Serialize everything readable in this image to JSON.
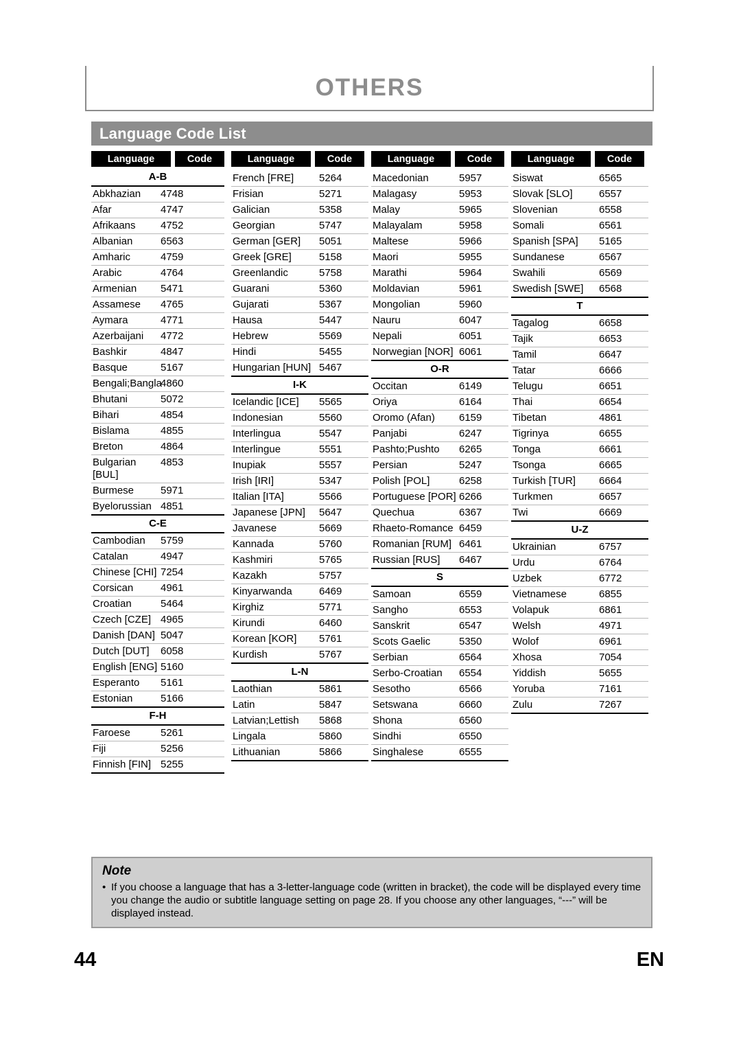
{
  "header": {
    "chapter_title": "OTHERS",
    "section_title": "Language Code List"
  },
  "table_headers": {
    "language": "Language",
    "code": "Code"
  },
  "columns": [
    {
      "id": "col-1",
      "blocks": [
        {
          "group": "A-B",
          "rows": [
            {
              "name": "Abkhazian",
              "code": "4748"
            },
            {
              "name": "Afar",
              "code": "4747"
            },
            {
              "name": "Afrikaans",
              "code": "4752"
            },
            {
              "name": "Albanian",
              "code": "6563"
            },
            {
              "name": "Amharic",
              "code": "4759"
            },
            {
              "name": "Arabic",
              "code": "4764"
            },
            {
              "name": "Armenian",
              "code": "5471"
            },
            {
              "name": "Assamese",
              "code": "4765"
            },
            {
              "name": "Aymara",
              "code": "4771"
            },
            {
              "name": "Azerbaijani",
              "code": "4772"
            },
            {
              "name": "Bashkir",
              "code": "4847"
            },
            {
              "name": "Basque",
              "code": "5167"
            },
            {
              "name": "Bengali;Bangla",
              "code": "4860"
            },
            {
              "name": "Bhutani",
              "code": "5072"
            },
            {
              "name": "Bihari",
              "code": "4854"
            },
            {
              "name": "Bislama",
              "code": "4855"
            },
            {
              "name": "Breton",
              "code": "4864"
            },
            {
              "name": "Bulgarian [BUL]",
              "code": "4853"
            },
            {
              "name": "Burmese",
              "code": "5971"
            },
            {
              "name": "Byelorussian",
              "code": "4851"
            }
          ]
        },
        {
          "group": "C-E",
          "rows": [
            {
              "name": "Cambodian",
              "code": "5759"
            },
            {
              "name": "Catalan",
              "code": "4947"
            },
            {
              "name": "Chinese [CHI]",
              "code": "7254"
            },
            {
              "name": "Corsican",
              "code": "4961"
            },
            {
              "name": "Croatian",
              "code": "5464"
            },
            {
              "name": "Czech [CZE]",
              "code": "4965"
            },
            {
              "name": "Danish [DAN]",
              "code": "5047"
            },
            {
              "name": "Dutch [DUT]",
              "code": "6058"
            },
            {
              "name": "English [ENG]",
              "code": "5160"
            },
            {
              "name": "Esperanto",
              "code": "5161"
            },
            {
              "name": "Estonian",
              "code": "5166"
            }
          ]
        },
        {
          "group": "F-H",
          "rows": [
            {
              "name": "Faroese",
              "code": "5261"
            },
            {
              "name": "Fiji",
              "code": "5256"
            },
            {
              "name": "Finnish [FIN]",
              "code": "5255"
            }
          ]
        }
      ]
    },
    {
      "id": "col-2",
      "blocks": [
        {
          "group": "",
          "rows": [
            {
              "name": "French [FRE]",
              "code": "5264"
            },
            {
              "name": "Frisian",
              "code": "5271"
            },
            {
              "name": "Galician",
              "code": "5358"
            },
            {
              "name": "Georgian",
              "code": "5747"
            },
            {
              "name": "German [GER]",
              "code": "5051"
            },
            {
              "name": "Greek [GRE]",
              "code": "5158"
            },
            {
              "name": "Greenlandic",
              "code": "5758"
            },
            {
              "name": "Guarani",
              "code": "5360"
            },
            {
              "name": "Gujarati",
              "code": "5367"
            },
            {
              "name": "Hausa",
              "code": "5447"
            },
            {
              "name": "Hebrew",
              "code": "5569"
            },
            {
              "name": "Hindi",
              "code": "5455"
            },
            {
              "name": "Hungarian [HUN]",
              "code": "5467"
            }
          ]
        },
        {
          "group": "I-K",
          "rows": [
            {
              "name": "Icelandic [ICE]",
              "code": "5565"
            },
            {
              "name": "Indonesian",
              "code": "5560"
            },
            {
              "name": "Interlingua",
              "code": "5547"
            },
            {
              "name": "Interlingue",
              "code": "5551"
            },
            {
              "name": "Inupiak",
              "code": "5557"
            },
            {
              "name": "Irish [IRI]",
              "code": "5347"
            },
            {
              "name": "Italian [ITA]",
              "code": "5566"
            },
            {
              "name": "Japanese [JPN]",
              "code": "5647"
            },
            {
              "name": "Javanese",
              "code": "5669"
            },
            {
              "name": "Kannada",
              "code": "5760"
            },
            {
              "name": "Kashmiri",
              "code": "5765"
            },
            {
              "name": "Kazakh",
              "code": "5757"
            },
            {
              "name": "Kinyarwanda",
              "code": "6469"
            },
            {
              "name": "Kirghiz",
              "code": "5771"
            },
            {
              "name": "Kirundi",
              "code": "6460"
            },
            {
              "name": "Korean [KOR]",
              "code": "5761"
            },
            {
              "name": "Kurdish",
              "code": "5767"
            }
          ]
        },
        {
          "group": "L-N",
          "rows": [
            {
              "name": "Laothian",
              "code": "5861"
            },
            {
              "name": "Latin",
              "code": "5847"
            },
            {
              "name": "Latvian;Lettish",
              "code": "5868"
            },
            {
              "name": "Lingala",
              "code": "5860"
            },
            {
              "name": "Lithuanian",
              "code": "5866"
            }
          ]
        }
      ]
    },
    {
      "id": "col-3",
      "blocks": [
        {
          "group": "",
          "rows": [
            {
              "name": "Macedonian",
              "code": "5957"
            },
            {
              "name": "Malagasy",
              "code": "5953"
            },
            {
              "name": "Malay",
              "code": "5965"
            },
            {
              "name": "Malayalam",
              "code": "5958"
            },
            {
              "name": "Maltese",
              "code": "5966"
            },
            {
              "name": "Maori",
              "code": "5955"
            },
            {
              "name": "Marathi",
              "code": "5964"
            },
            {
              "name": "Moldavian",
              "code": "5961"
            },
            {
              "name": "Mongolian",
              "code": "5960"
            },
            {
              "name": "Nauru",
              "code": "6047"
            },
            {
              "name": "Nepali",
              "code": "6051"
            },
            {
              "name": "Norwegian [NOR]",
              "code": "6061"
            }
          ]
        },
        {
          "group": "O-R",
          "rows": [
            {
              "name": "Occitan",
              "code": "6149"
            },
            {
              "name": "Oriya",
              "code": "6164"
            },
            {
              "name": "Oromo (Afan)",
              "code": "6159"
            },
            {
              "name": "Panjabi",
              "code": "6247"
            },
            {
              "name": "Pashto;Pushto",
              "code": "6265"
            },
            {
              "name": "Persian",
              "code": "5247"
            },
            {
              "name": "Polish [POL]",
              "code": "6258"
            },
            {
              "name": "Portuguese [POR]",
              "code": "6266"
            },
            {
              "name": "Quechua",
              "code": "6367"
            },
            {
              "name": "Rhaeto-Romance",
              "code": "6459"
            },
            {
              "name": "Romanian [RUM]",
              "code": "6461"
            },
            {
              "name": "Russian [RUS]",
              "code": "6467"
            }
          ]
        },
        {
          "group": "S",
          "rows": [
            {
              "name": "Samoan",
              "code": "6559"
            },
            {
              "name": "Sangho",
              "code": "6553"
            },
            {
              "name": "Sanskrit",
              "code": "6547"
            },
            {
              "name": "Scots Gaelic",
              "code": "5350"
            },
            {
              "name": "Serbian",
              "code": "6564"
            },
            {
              "name": "Serbo-Croatian",
              "code": "6554"
            },
            {
              "name": "Sesotho",
              "code": "6566"
            },
            {
              "name": "Setswana",
              "code": "6660"
            },
            {
              "name": "Shona",
              "code": "6560"
            },
            {
              "name": "Sindhi",
              "code": "6550"
            },
            {
              "name": "Singhalese",
              "code": "6555"
            }
          ]
        }
      ]
    },
    {
      "id": "col-4",
      "blocks": [
        {
          "group": "",
          "rows": [
            {
              "name": "Siswat",
              "code": "6565"
            },
            {
              "name": "Slovak [SLO]",
              "code": "6557"
            },
            {
              "name": "Slovenian",
              "code": "6558"
            },
            {
              "name": "Somali",
              "code": "6561"
            },
            {
              "name": "Spanish [SPA]",
              "code": "5165"
            },
            {
              "name": "Sundanese",
              "code": "6567"
            },
            {
              "name": "Swahili",
              "code": "6569"
            },
            {
              "name": "Swedish [SWE]",
              "code": "6568"
            }
          ]
        },
        {
          "group": "T",
          "rows": [
            {
              "name": "Tagalog",
              "code": "6658"
            },
            {
              "name": "Tajik",
              "code": "6653"
            },
            {
              "name": "Tamil",
              "code": "6647"
            },
            {
              "name": "Tatar",
              "code": "6666"
            },
            {
              "name": "Telugu",
              "code": "6651"
            },
            {
              "name": "Thai",
              "code": "6654"
            },
            {
              "name": "Tibetan",
              "code": "4861"
            },
            {
              "name": "Tigrinya",
              "code": "6655"
            },
            {
              "name": "Tonga",
              "code": "6661"
            },
            {
              "name": "Tsonga",
              "code": "6665"
            },
            {
              "name": "Turkish [TUR]",
              "code": "6664"
            },
            {
              "name": "Turkmen",
              "code": "6657"
            },
            {
              "name": "Twi",
              "code": "6669"
            }
          ]
        },
        {
          "group": "U-Z",
          "rows": [
            {
              "name": "Ukrainian",
              "code": "6757"
            },
            {
              "name": "Urdu",
              "code": "6764"
            },
            {
              "name": "Uzbek",
              "code": "6772"
            },
            {
              "name": "Vietnamese",
              "code": "6855"
            },
            {
              "name": "Volapuk",
              "code": "6861"
            },
            {
              "name": "Welsh",
              "code": "4971"
            },
            {
              "name": "Wolof",
              "code": "6961"
            },
            {
              "name": "Xhosa",
              "code": "7054"
            },
            {
              "name": "Yiddish",
              "code": "5655"
            },
            {
              "name": "Yoruba",
              "code": "7161"
            },
            {
              "name": "Zulu",
              "code": "7267"
            }
          ]
        }
      ]
    }
  ],
  "note": {
    "title": "Note",
    "items": [
      "If you choose a language that has a 3-letter-language code (written in bracket), the code will be displayed every time you change the audio or subtitle language setting on page 28. If you choose any other languages, “---” will be displayed instead."
    ]
  },
  "footer": {
    "page_number": "44",
    "language_code": "EN"
  },
  "colors": {
    "banner_gray": "#8d8d8d",
    "chip_black": "#000000",
    "note_bg": "#cfcfcf",
    "rule_gray": "#b8b8b8"
  }
}
